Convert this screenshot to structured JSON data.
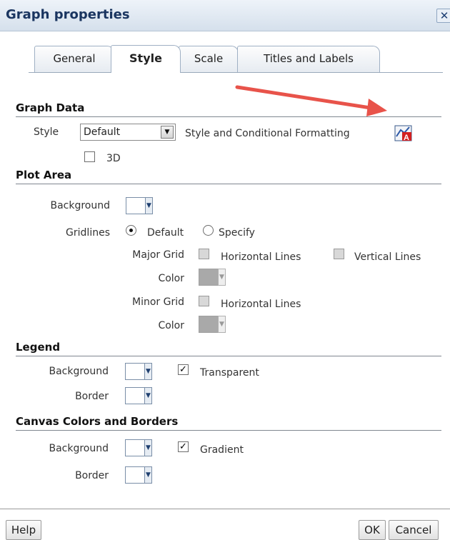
{
  "dialog": {
    "title": "Graph properties",
    "close_icon": "close-icon"
  },
  "tabs": [
    {
      "label": "General",
      "active": false
    },
    {
      "label": "Style",
      "active": true
    },
    {
      "label": "Scale",
      "active": false
    },
    {
      "label": "Titles and Labels",
      "active": false
    }
  ],
  "graph_data": {
    "title": "Graph Data",
    "style_label": "Style",
    "style_value": "Default",
    "conditional_label": "Style and Conditional Formatting",
    "three_d_label": "3D",
    "three_d_checked": false
  },
  "plot_area": {
    "title": "Plot Area",
    "background_label": "Background",
    "gridlines_label": "Gridlines",
    "default_label": "Default",
    "specify_label": "Specify",
    "gridlines_selected": "Default",
    "major_grid_label": "Major Grid",
    "horizontal_lines_label": "Horizontal Lines",
    "vertical_lines_label": "Vertical Lines",
    "color_label": "Color",
    "minor_grid_label": "Minor Grid",
    "minor_horizontal_label": "Horizontal Lines",
    "minor_color_label": "Color"
  },
  "legend": {
    "title": "Legend",
    "background_label": "Background",
    "transparent_label": "Transparent",
    "transparent_checked": true,
    "border_label": "Border"
  },
  "canvas": {
    "title": "Canvas Colors and Borders",
    "background_label": "Background",
    "gradient_label": "Gradient",
    "gradient_checked": true,
    "border_label": "Border"
  },
  "footer": {
    "help_label": "Help",
    "ok_label": "OK",
    "cancel_label": "Cancel"
  },
  "colors": {
    "title_text": "#1a3560",
    "annotation_arrow": "#e8534a",
    "disabled_swatch": "#a9a9a9"
  }
}
